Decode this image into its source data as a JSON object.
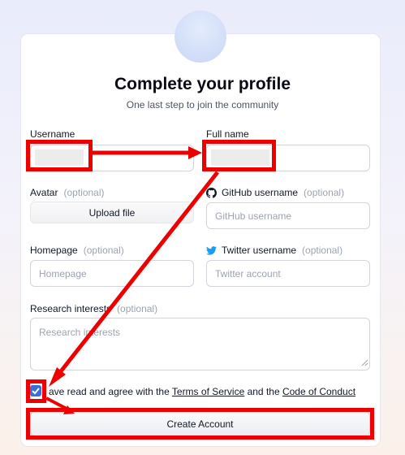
{
  "header": {
    "title": "Complete your profile",
    "subtitle": "One last step to join the community"
  },
  "form": {
    "username_label": "Username",
    "fullname_label": "Full name",
    "avatar_label": "Avatar",
    "avatar_optional": "(optional)",
    "upload_label": "Upload file",
    "github_label": "GitHub username",
    "github_optional": "(optional)",
    "github_placeholder": "GitHub username",
    "homepage_label": "Homepage",
    "homepage_optional": "(optional)",
    "homepage_placeholder": "Homepage",
    "twitter_label": "Twitter username",
    "twitter_optional": "(optional)",
    "twitter_placeholder": "Twitter account",
    "research_label": "Research interests",
    "research_optional": "(optional)",
    "research_placeholder": "Research interests",
    "terms_visible_text": "ave read and agree with the ",
    "terms_link": "Terms of Service",
    "terms_mid": " and the ",
    "conduct_link": "Code of Conduct",
    "agree_checked": true,
    "submit_label": "Create Account"
  },
  "colors": {
    "annotation_red": "#ee0000",
    "checkbox_blue": "#3b6fd8",
    "twitter_blue": "#1d9bf0"
  }
}
